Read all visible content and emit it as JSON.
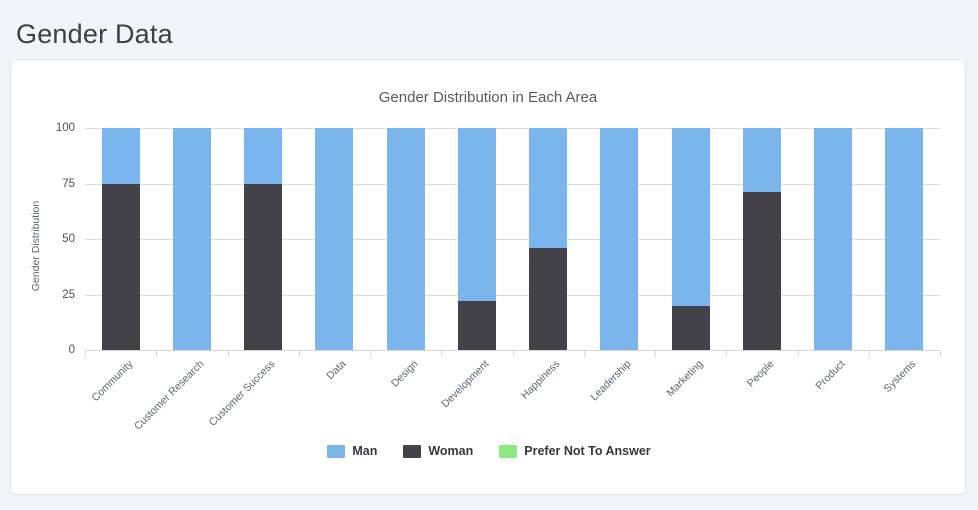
{
  "page": {
    "title": "Gender Data",
    "background_color": "#f2f5f8"
  },
  "card": {
    "background_color": "#ffffff",
    "border_color": "#e2e4e7"
  },
  "legend": {
    "position": "bottom-center",
    "items": [
      {
        "label": "Man",
        "color": "#7ab5ed",
        "swatch_name": "legend-swatch-man"
      },
      {
        "label": "Woman",
        "color": "#434248",
        "swatch_name": "legend-swatch-woman"
      },
      {
        "label": "Prefer Not To Answer",
        "color": "#8ce97f",
        "swatch_name": "legend-swatch-prefer-not-to-answer"
      }
    ]
  },
  "chart_data": {
    "type": "bar",
    "stacked": true,
    "title": "Gender Distribution in Each Area",
    "xlabel": "",
    "ylabel": "Gender Distribution",
    "ylim": [
      0,
      100
    ],
    "yticks": [
      0,
      25,
      50,
      75,
      100
    ],
    "grid": true,
    "legend_position": "bottom",
    "categories": [
      "Community",
      "Customer Research",
      "Customer Success",
      "Data",
      "Design",
      "Development",
      "Happiness",
      "Leadership",
      "Marketing",
      "People",
      "Product",
      "Systems"
    ],
    "series": [
      {
        "name": "Man",
        "color": "#7ab5ed",
        "values": [
          25,
          100,
          25,
          100,
          100,
          78,
          54,
          100,
          80,
          29,
          100,
          100
        ]
      },
      {
        "name": "Woman",
        "color": "#434248",
        "values": [
          75,
          0,
          75,
          0,
          0,
          22,
          46,
          0,
          20,
          71,
          0,
          0
        ]
      },
      {
        "name": "Prefer Not To Answer",
        "color": "#8ce97f",
        "values": [
          0,
          0,
          0,
          0,
          0,
          0,
          0,
          0,
          0,
          0,
          0,
          0
        ]
      }
    ]
  }
}
